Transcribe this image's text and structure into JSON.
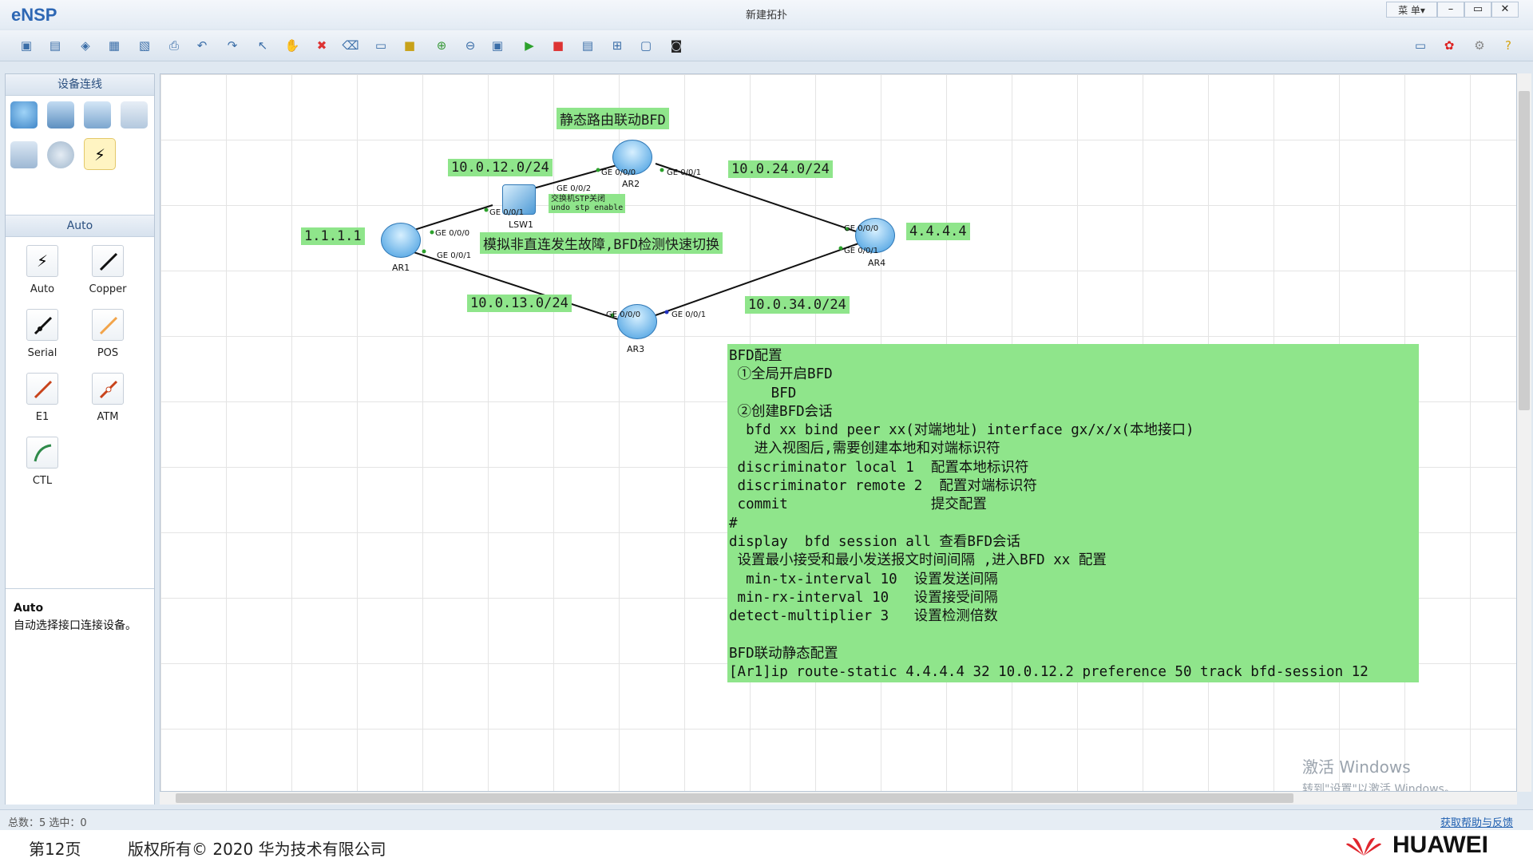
{
  "window": {
    "logo": "eNSP",
    "title": "新建拓扑",
    "menu": "菜 单▾",
    "minimize": "–",
    "restore": "▭",
    "close": "✕"
  },
  "left_panel": {
    "devices_header": "设备连线",
    "auto_header": "Auto",
    "connections": [
      {
        "label": "Auto"
      },
      {
        "label": "Copper"
      },
      {
        "label": "Serial"
      },
      {
        "label": "POS"
      },
      {
        "label": "E1"
      },
      {
        "label": "ATM"
      },
      {
        "label": "CTL"
      }
    ],
    "desc_title": "Auto",
    "desc_text": "自动选择接口连接设备。"
  },
  "topology": {
    "title": "静态路由联动BFD",
    "fault_note": "模拟非直连发生故障,BFD检测快速切换",
    "switch_note_1": "交换机STP关闭",
    "switch_note_2": "undo stp enable",
    "networks": {
      "n12": "10.0.12.0/24",
      "n24": "10.0.24.0/24",
      "n13": "10.0.13.0/24",
      "n34": "10.0.34.0/24",
      "ar1": "1.1.1.1",
      "ar4": "4.4.4.4"
    },
    "devices": {
      "ar1": "AR1",
      "ar2": "AR2",
      "ar3": "AR3",
      "ar4": "AR4",
      "lsw1": "LSW1"
    },
    "ports": {
      "ar1_g000": "GE 0/0/0",
      "ar1_g001": "GE 0/0/1",
      "lsw_g001": "GE 0/0/1",
      "lsw_g002": "GE 0/0/2",
      "ar2_g000": "GE 0/0/0",
      "ar2_g001": "GE 0/0/1",
      "ar3_g000": "GE 0/0/0",
      "ar3_g001": "GE 0/0/1",
      "ar4_g000": "GE 0/0/0",
      "ar4_g001": "GE 0/0/1"
    }
  },
  "config_lines": [
    "BFD配置",
    " ①全局开启BFD",
    "     BFD",
    " ②创建BFD会话",
    "  bfd xx bind peer xx(对端地址) interface gx/x/x(本地接口)",
    "   进入视图后,需要创建本地和对端标识符",
    " discriminator local 1  配置本地标识符",
    " discriminator remote 2  配置对端标识符",
    " commit                 提交配置",
    "#",
    "display  bfd session all 查看BFD会话",
    " 设置最小接受和最小发送报文时间间隔 ,进入BFD xx 配置",
    "  min-tx-interval 10  设置发送间隔",
    " min-rx-interval 10   设置接受间隔",
    "detect-multiplier 3   设置检测倍数",
    "",
    "BFD联动静态配置",
    "[Ar1]ip route-static 4.4.4.4 32 10.0.12.2 preference 50 track bfd-session 12"
  ],
  "watermark": {
    "line1": "激活 Windows",
    "line2": "转到\"设置\"以激活 Windows。"
  },
  "status": {
    "left": "总数：5  选中：0",
    "right": "获取帮助与反馈"
  },
  "footer": {
    "page": "第12页",
    "copyright": "版权所有© 2020 华为技术有限公司",
    "brand": "HUAWEI"
  }
}
